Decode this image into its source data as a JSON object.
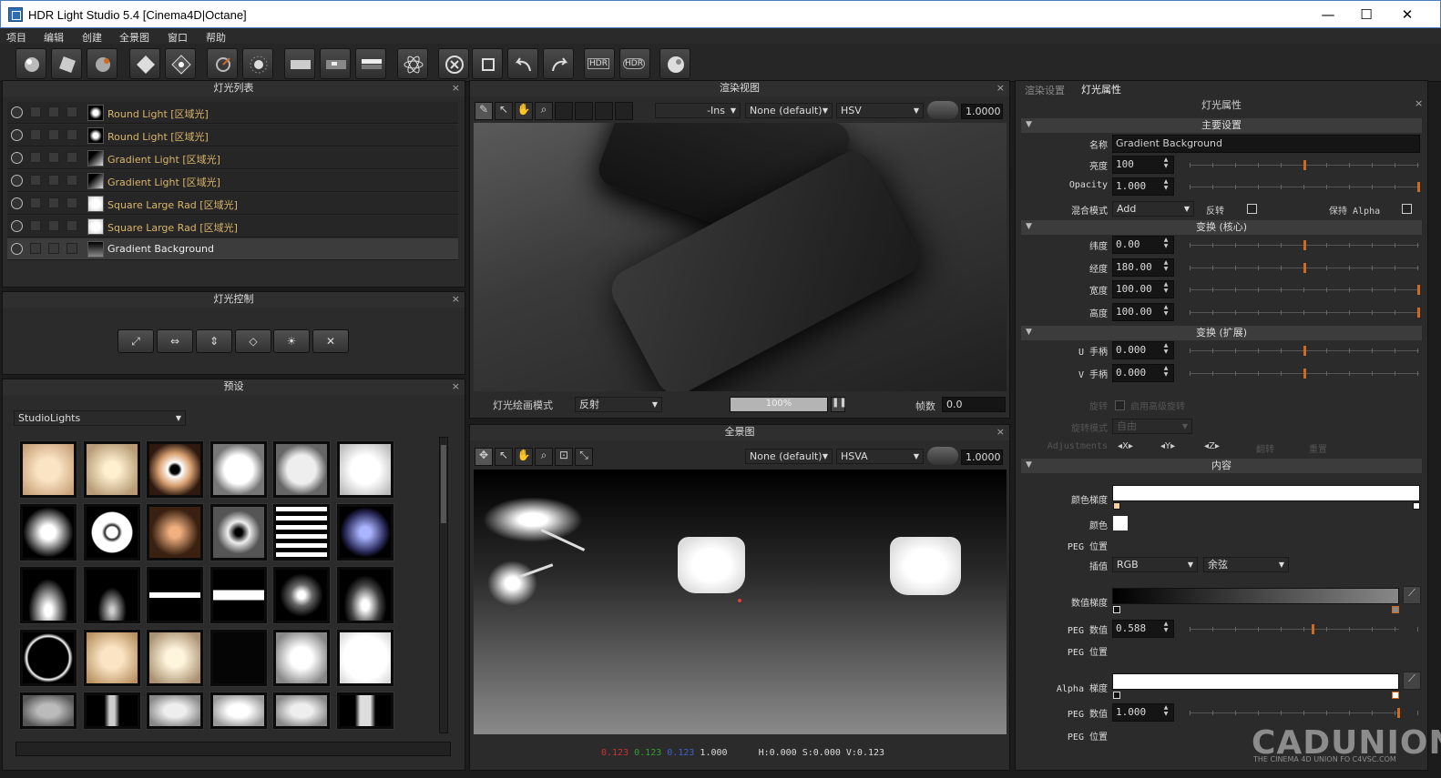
{
  "window": {
    "title": "HDR Light Studio 5.4 [Cinema4D|Octane]",
    "min": "—",
    "max": "☐",
    "close": "✕"
  },
  "menu": [
    "项目",
    "编辑",
    "创建",
    "全景图",
    "窗口",
    "帮助"
  ],
  "toolbar": {
    "hdr1": "HDR",
    "hdr2": "HDR"
  },
  "light_list": {
    "title": "灯光列表",
    "close": "×",
    "items": [
      {
        "label": "Round Light [区域光]",
        "type": "round"
      },
      {
        "label": "Round Light [区域光]",
        "type": "round"
      },
      {
        "label": "Gradient Light [区域光]",
        "type": "gradient"
      },
      {
        "label": "Gradient Light [区域光]",
        "type": "gradient"
      },
      {
        "label": "Square Large Rad [区域光]",
        "type": "square"
      },
      {
        "label": "Square Large Rad [区域光]",
        "type": "square"
      },
      {
        "label": "Gradient Background",
        "type": "bg",
        "selected": true
      }
    ]
  },
  "light_control": {
    "title": "灯光控制",
    "close": "×"
  },
  "presets": {
    "title": "预设",
    "close": "×",
    "category": "StudioLights"
  },
  "render_view": {
    "title": "渲染视图",
    "close": "×",
    "ins_label": "-Ins",
    "profile": "None (default)",
    "mode": "HSV",
    "value": "1.0000",
    "paint_mode_label": "灯光绘画模式",
    "paint_mode": "反射",
    "progress": "100%",
    "progress_value": 1.0,
    "frames_label": "帧数",
    "frames": "0.0"
  },
  "panorama": {
    "title": "全景图",
    "close": "×",
    "profile": "None (default)",
    "mode": "HSVA",
    "value": "1.0000",
    "status": {
      "r": "0.123",
      "g": "0.123",
      "b": "0.123",
      "a": "1.000",
      "hsv": "H:0.000 S:0.000 V:0.123"
    }
  },
  "tabs": {
    "render_settings": "渲染设置",
    "light_props": "灯光属性"
  },
  "props": {
    "title": "灯光属性",
    "close": "×",
    "sec_main": "主要设置",
    "name_label": "名称",
    "name": "Gradient Background",
    "brightness_label": "亮度",
    "brightness": "100",
    "opacity_label": "Opacity",
    "opacity": "1.000",
    "blend_label": "混合模式",
    "blend": "Add",
    "flip_label": "反转",
    "keep_alpha_label": "保持 Alpha",
    "sec_transform": "变换 (核心)",
    "lat_label": "纬度",
    "lat": "0.00",
    "lon_label": "经度",
    "lon": "180.00",
    "width_label": "宽度",
    "width": "100.00",
    "height_label": "高度",
    "height": "100.00",
    "sec_transform_ext": "变换 (扩展)",
    "u_label": "U 手柄",
    "u": "0.000",
    "v_label": "V 手柄",
    "v": "0.000",
    "rotate_label": "旋转",
    "adv_rotate": "启用高级旋转",
    "rotate_mode_label": "旋转模式",
    "rotate_mode": "自由",
    "adjust_label": "Adjustments",
    "ax_x": "X",
    "ax_y": "Y",
    "ax_z": "Z",
    "flip2": "翻转",
    "reset": "重置",
    "sec_content": "内容",
    "color_grad_label": "颜色梯度",
    "color_label": "颜色",
    "peg_pos_label": "PEG 位置",
    "interp_label": "插值",
    "interp": "RGB",
    "interp2": "余弦",
    "value_grad_label": "数值梯度",
    "peg_value_label": "PEG 数值",
    "peg_value": "0.588",
    "peg_pos2_label": "PEG 位置",
    "alpha_grad_label": "Alpha 梯度",
    "peg_value2_label": "PEG 数值",
    "peg_value2": "1.000",
    "peg_pos3_label": "PEG 位置"
  },
  "watermark": {
    "brand": "CADUNION",
    "sub": "THE CINEMA 4D UNION FO C4VSC.COM"
  },
  "colors": {
    "accent": "#d06a20",
    "label_gold": "#d9b56a"
  }
}
